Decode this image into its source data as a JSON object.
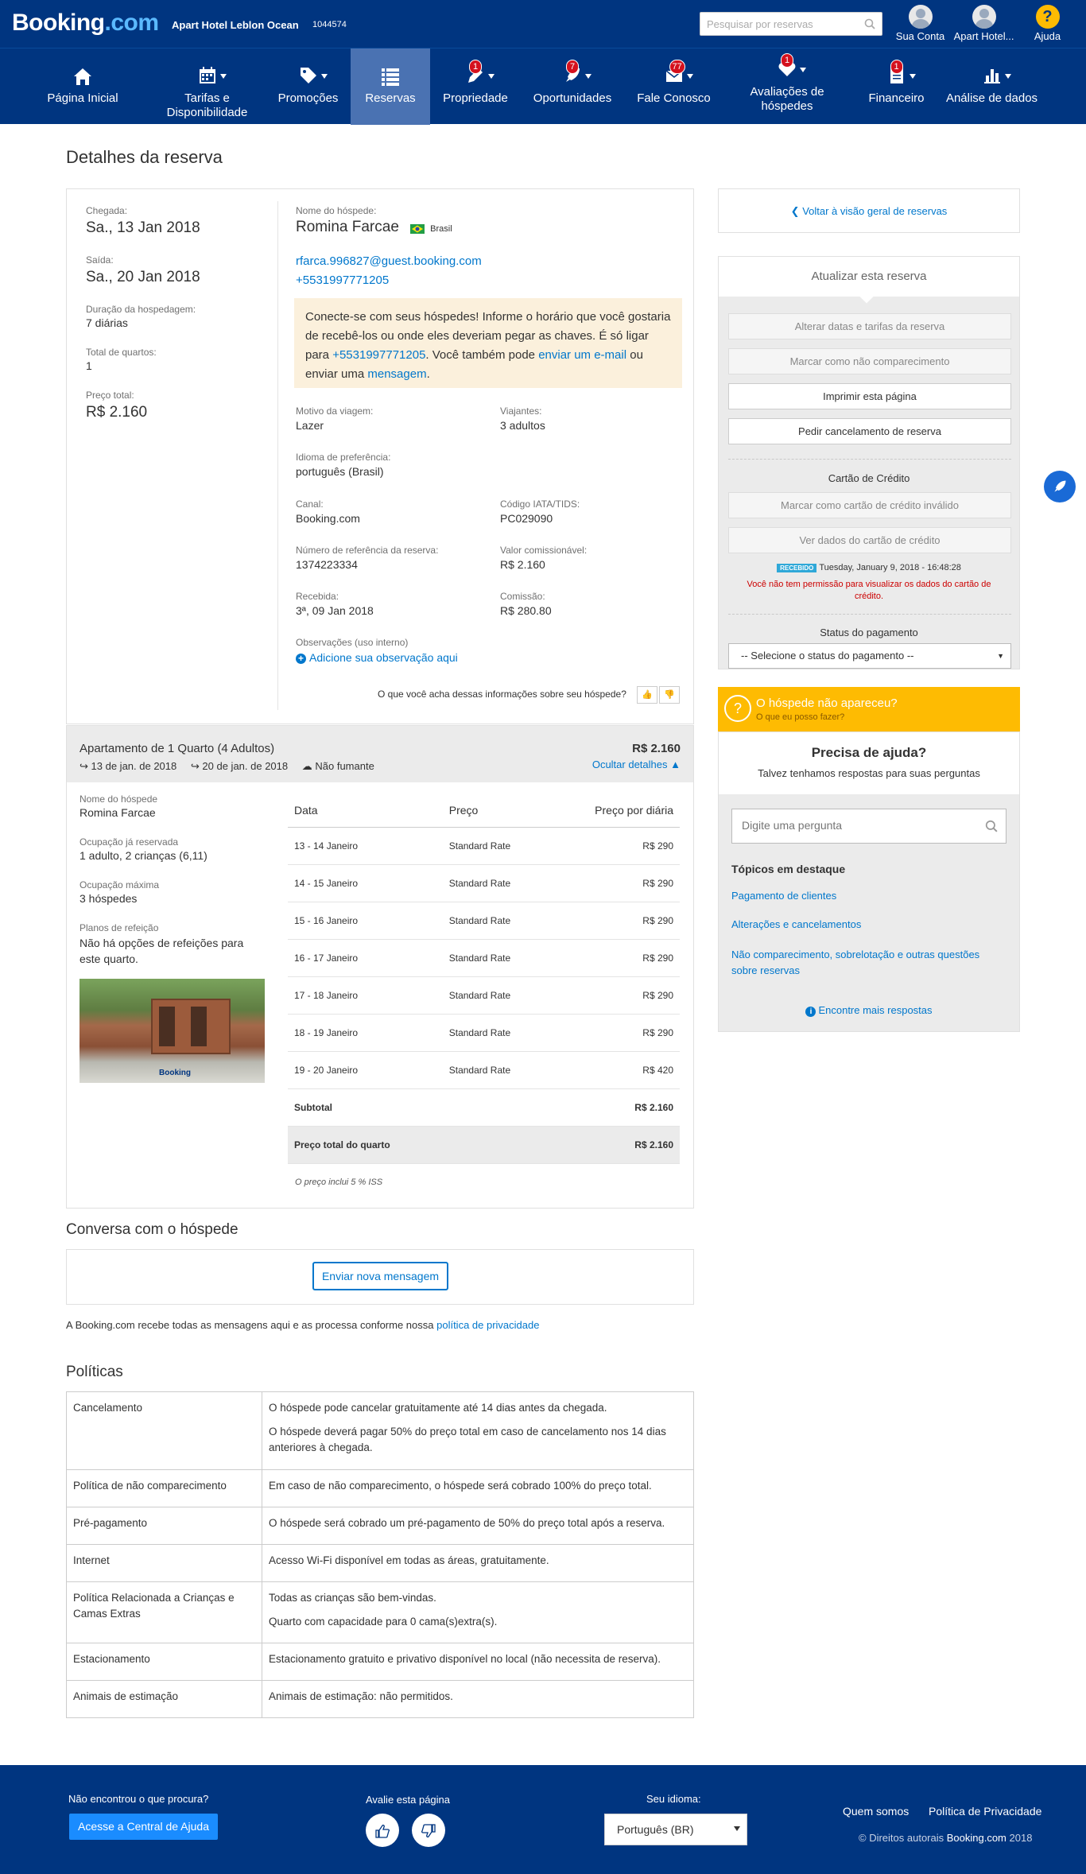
{
  "header": {
    "logo_main": "Booking",
    "logo_dot": ".com",
    "hotel_name": "Apart Hotel Leblon Ocean",
    "hotel_id": "1044574",
    "search_placeholder": "Pesquisar por reservas",
    "account_label": "Sua Conta",
    "hotel_label": "Apart Hotel...",
    "help_label": "Ajuda",
    "help_glyph": "?"
  },
  "nav": {
    "items": [
      {
        "label": "Página Inicial",
        "icon": "home-icon"
      },
      {
        "label": "Tarifas e Disponibilidade",
        "icon": "calendar-icon"
      },
      {
        "label": "Promoções",
        "icon": "tag-icon"
      },
      {
        "label": "Reservas",
        "icon": "list-icon"
      },
      {
        "label": "Propriedade",
        "icon": "pencil-icon",
        "badge": "1"
      },
      {
        "label": "Oportunidades",
        "icon": "rocket-icon",
        "badge": "7"
      },
      {
        "label": "Fale Conosco",
        "icon": "envelope-icon",
        "badge": "77"
      },
      {
        "label": "Avaliações de hóspedes",
        "icon": "heart-icon",
        "badge": "1"
      },
      {
        "label": "Financeiro",
        "icon": "document-icon",
        "badge": "1"
      },
      {
        "label": "Análise de dados",
        "icon": "bar-chart-icon"
      }
    ]
  },
  "page_title": "Detalhes da reserva",
  "booking": {
    "checkin_label": "Chegada:",
    "checkin": "Sa., 13 Jan 2018",
    "checkout_label": "Saída:",
    "checkout": "Sa., 20 Jan 2018",
    "duration_label": "Duração da hospedagem:",
    "duration": "7 diárias",
    "rooms_label": "Total de quartos:",
    "rooms": "1",
    "price_label": "Preço total:",
    "price": "R$ 2.160"
  },
  "guest": {
    "name_label": "Nome do hóspede:",
    "name": "Romina Farcae",
    "country": "Brasil",
    "email": "rfarca.996827@guest.booking.com",
    "phone": "+5531997771205",
    "hint_1": "Conecte-se com seus hóspedes! Informe o horário que você gostaria de recebê-los ou onde eles deveriam pegar as chaves. É só ligar para ",
    "hint_phone": "+5531997771205",
    "hint_2": ". Você também pode ",
    "hint_email": "enviar um e-mail",
    "hint_3": " ou enviar uma ",
    "hint_msg": "mensagem",
    "hint_4": ".",
    "trip_label": "Motivo da viagem:",
    "trip": "Lazer",
    "travelers_label": "Viajantes:",
    "travelers": "3 adultos",
    "lang_label": "Idioma de preferência:",
    "lang": "português (Brasil)",
    "channel_label": "Canal:",
    "channel": "Booking.com",
    "iata_label": "Código IATA/TIDS:",
    "iata": "PC029090",
    "ref_label": "Número de referência da reserva:",
    "ref": "1374223334",
    "commissionable_label": "Valor comissionável:",
    "commissionable": "R$ 2.160",
    "received_label": "Recebida:",
    "received": "3ª, 09 Jan 2018",
    "commission_label": "Comissão:",
    "commission": "R$ 280.80",
    "notes_label": "Observações (uso interno)",
    "add_note": "Adicione sua observação aqui",
    "feedback": "O que você acha dessas informações sobre seu hóspede?"
  },
  "room": {
    "title": "Apartamento de 1 Quarto (4 Adultos)",
    "price": "R$ 2.160",
    "checkin": "13 de jan. de 2018",
    "checkout": "20 de jan. de 2018",
    "smoking": "Não fumante",
    "hide_details": "Ocultar detalhes",
    "guest_label": "Nome do hóspede",
    "guest": "Romina Farcae",
    "occupancy_label": "Ocupação já reservada",
    "occupancy": "1 adulto, 2 crianças (6,11)",
    "max_label": "Ocupação máxima",
    "max": "3 hóspedes",
    "meal_label": "Planos de refeição",
    "meal": "Não há opções de refeições para este quarto.",
    "photo_caption": "Booking",
    "col_date": "Data",
    "col_price": "Preço",
    "col_daily": "Preço por diária",
    "rows": [
      {
        "date": "13 - 14 Janeiro",
        "rate": "Standard Rate",
        "amount": "R$ 290"
      },
      {
        "date": "14 - 15 Janeiro",
        "rate": "Standard Rate",
        "amount": "R$ 290"
      },
      {
        "date": "15 - 16 Janeiro",
        "rate": "Standard Rate",
        "amount": "R$ 290"
      },
      {
        "date": "16 - 17 Janeiro",
        "rate": "Standard Rate",
        "amount": "R$ 290"
      },
      {
        "date": "17 - 18 Janeiro",
        "rate": "Standard Rate",
        "amount": "R$ 290"
      },
      {
        "date": "18 - 19 Janeiro",
        "rate": "Standard Rate",
        "amount": "R$ 290"
      },
      {
        "date": "19 - 20 Janeiro",
        "rate": "Standard Rate",
        "amount": "R$ 420"
      }
    ],
    "subtotal_label": "Subtotal",
    "subtotal": "R$ 2.160",
    "total_label": "Preço total do quarto",
    "total": "R$ 2.160",
    "tax_note": "O preço inclui 5 % ISS"
  },
  "conversation": {
    "title": "Conversa com o hóspede",
    "button": "Enviar nova mensagem",
    "note": "A Booking.com recebe todas as mensagens aqui e as processa conforme nossa ",
    "privacy_link": "política de privacidade"
  },
  "policies": {
    "title": "Políticas",
    "rows": [
      {
        "name": "Cancelamento",
        "lines": [
          "O hóspede pode cancelar gratuitamente até 14 dias antes da chegada.",
          "O hóspede deverá pagar 50% do preço total em caso de cancelamento nos 14 dias anteriores à chegada."
        ]
      },
      {
        "name": "Política de não comparecimento",
        "lines": [
          "Em caso de não comparecimento, o hóspede será cobrado 100% do preço total."
        ]
      },
      {
        "name": "Pré-pagamento",
        "lines": [
          "O hóspede será cobrado um pré-pagamento de 50% do preço total após a reserva."
        ]
      },
      {
        "name": "Internet",
        "lines": [
          "Acesso Wi-Fi disponível em todas as áreas, gratuitamente."
        ]
      },
      {
        "name": "Política Relacionada a Crianças e Camas Extras",
        "lines": [
          "Todas as crianças são bem-vindas.",
          "Quarto com capacidade para 0 cama(s)extra(s)."
        ]
      },
      {
        "name": "Estacionamento",
        "lines": [
          "Estacionamento gratuito e privativo disponível no local (não necessita de reserva)."
        ]
      },
      {
        "name": "Animais de estimação",
        "lines": [
          "Animais de estimação: não permitidos."
        ]
      }
    ]
  },
  "sidebar": {
    "back": "Voltar à visão geral de reservas",
    "update_title": "Atualizar esta reserva",
    "change_dates": "Alterar datas e tarifas da reserva",
    "no_show": "Marcar como não comparecimento",
    "print": "Imprimir esta página",
    "cancel": "Pedir cancelamento de reserva",
    "cc_title": "Cartão de Crédito",
    "cc_invalid": "Marcar como cartão de crédito inválido",
    "cc_view": "Ver dados do cartão de crédito",
    "received_badge": "RECEBIDO",
    "received_time": "Tuesday, January 9, 2018 - 16:48:28",
    "no_permission": "Você não tem permissão para visualizar os dados do cartão de crédito.",
    "payment_title": "Status do pagamento",
    "payment_select": "-- Selecione o status do pagamento --",
    "noshow_banner": "O hóspede não apareceu?",
    "noshow_sub": "O que eu posso fazer?",
    "help_title": "Precisa de ajuda?",
    "help_sub": "Talvez tenhamos respostas para suas perguntas",
    "help_placeholder": "Digite uma pergunta",
    "topics_title": "Tópicos em destaque",
    "topics": [
      "Pagamento de clientes",
      "Alterações e cancelamentos",
      "Não comparecimento, sobrelotação e outras questões sobre reservas"
    ],
    "more": "Encontre mais respostas"
  },
  "footer": {
    "not_found": "Não encontrou o que procura?",
    "help_center": "Acesse a Central de Ajuda",
    "rate": "Avalie esta página",
    "language_label": "Seu idioma:",
    "language": "Português (BR)",
    "about": "Quem somos",
    "privacy": "Política de Privacidade",
    "copyright": "© Direitos autorais ",
    "copyright_brand": "Booking.com",
    "copyright_year": " 2018"
  },
  "colors": {
    "brand": "#003580",
    "accent": "#febb02",
    "link": "#0077cc",
    "alert": "#d4111e"
  }
}
